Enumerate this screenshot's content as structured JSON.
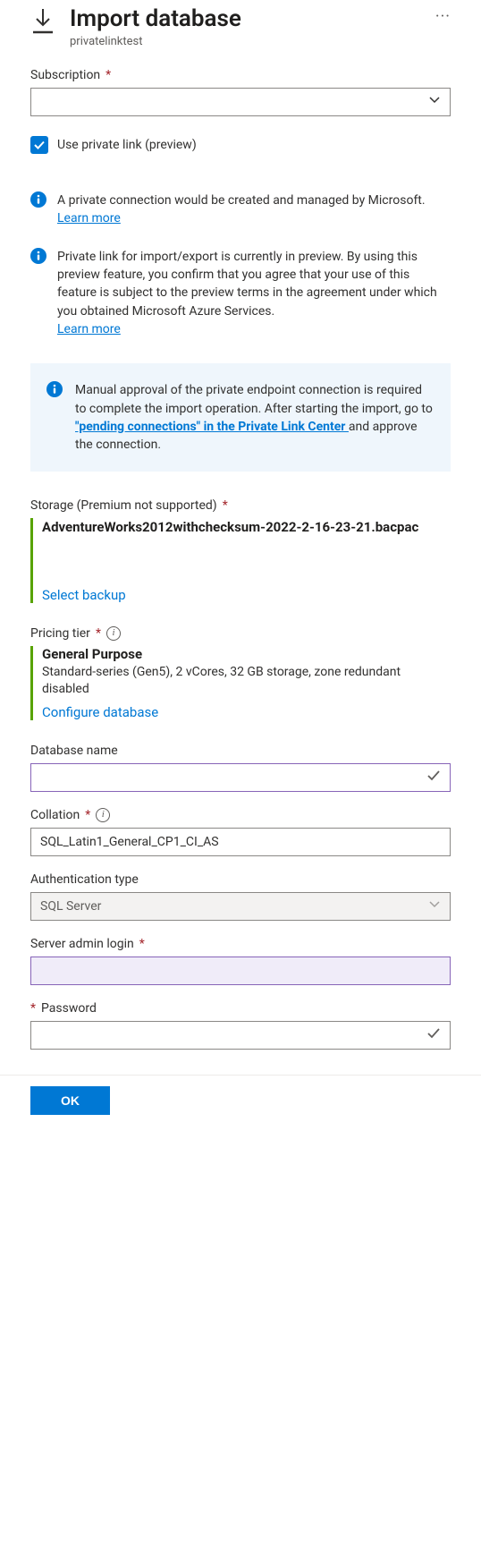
{
  "header": {
    "title": "Import database",
    "subtitle": "privatelinktest"
  },
  "subscription": {
    "label": "Subscription",
    "value": ""
  },
  "privateLink": {
    "checkboxLabel": "Use private link (preview)",
    "info1": "A private connection would be created and managed by Microsoft.",
    "learnMore": "Learn more",
    "info2": "Private link for import/export is currently in preview. By using this preview feature, you confirm that you agree that your use of this feature is subject to the preview terms in the agreement under which you obtained Microsoft Azure Services.",
    "calloutPrefix": "Manual approval of the private endpoint connection is required to complete the import operation. After starting the import, go to ",
    "calloutLink": "\"pending connections\" in the Private Link Center ",
    "calloutSuffix": "and approve the connection."
  },
  "storage": {
    "label": "Storage (Premium not supported)",
    "fileName": "AdventureWorks2012withchecksum-2022-2-16-23-21.bacpac",
    "selectBackup": "Select backup"
  },
  "pricingTier": {
    "label": "Pricing tier",
    "name": "General Purpose",
    "desc": "Standard-series (Gen5), 2 vCores, 32 GB storage, zone redundant disabled",
    "configure": "Configure database"
  },
  "databaseName": {
    "label": "Database name",
    "value": ""
  },
  "collation": {
    "label": "Collation",
    "value": "SQL_Latin1_General_CP1_CI_AS"
  },
  "authType": {
    "label": "Authentication type",
    "value": "SQL Server"
  },
  "adminLogin": {
    "label": "Server admin login",
    "value": ""
  },
  "password": {
    "label": "Password",
    "value": ""
  },
  "footer": {
    "ok": "OK"
  }
}
